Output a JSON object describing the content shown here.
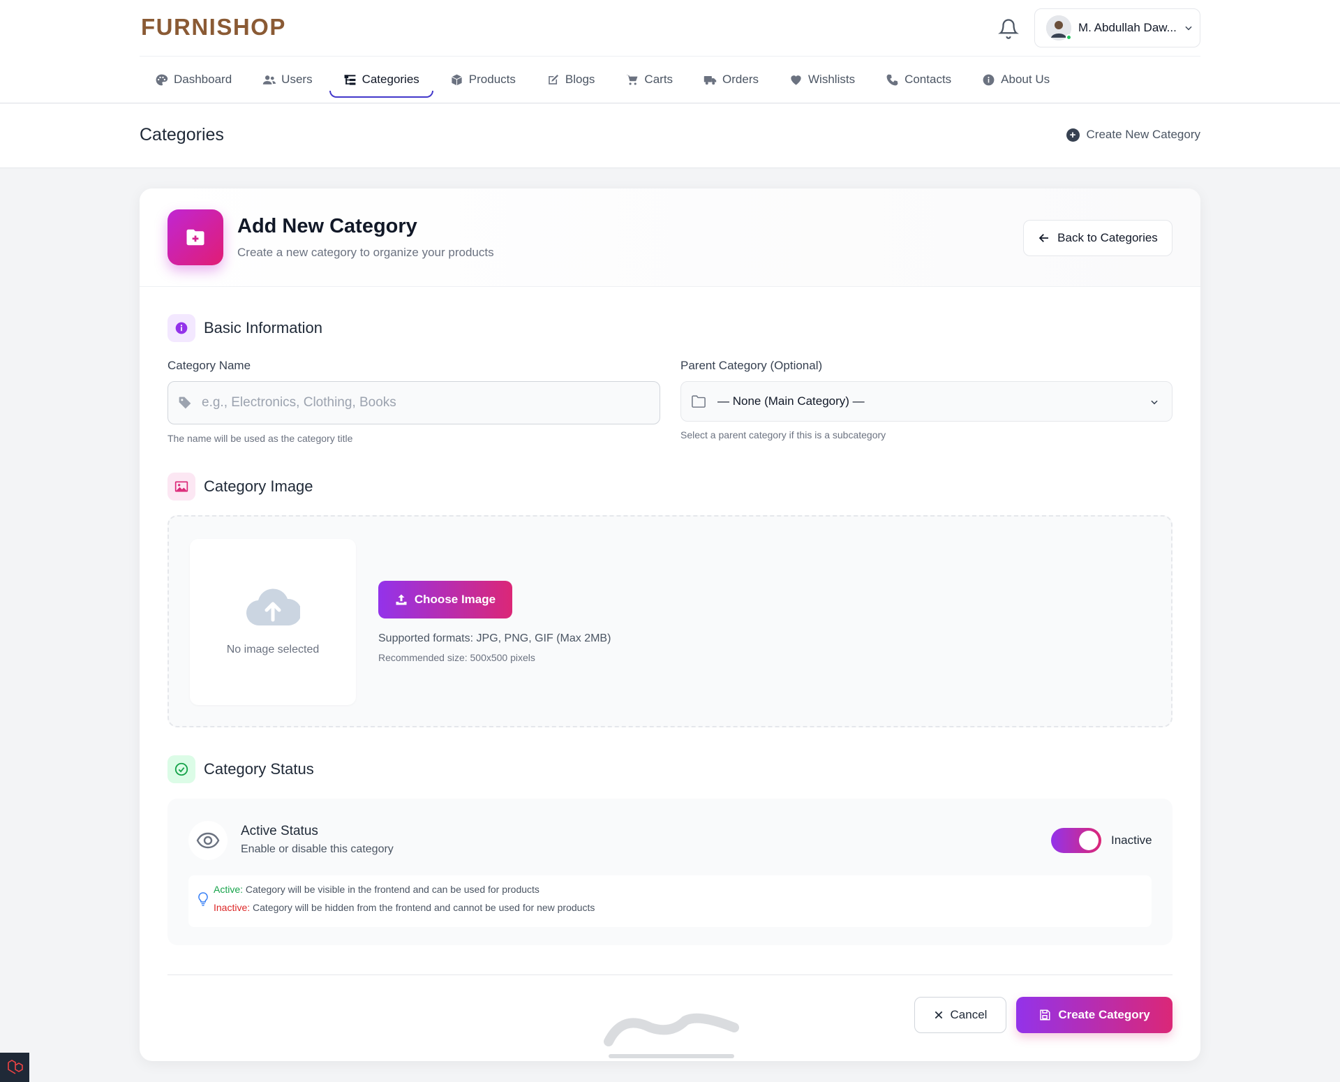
{
  "brand": "FURNISHOP",
  "user": {
    "name": "M. Abdullah Daw..."
  },
  "nav": [
    {
      "label": "Dashboard",
      "icon": "palette-icon"
    },
    {
      "label": "Users",
      "icon": "users-icon"
    },
    {
      "label": "Categories",
      "icon": "sitemap-icon",
      "active": true
    },
    {
      "label": "Products",
      "icon": "box-icon"
    },
    {
      "label": "Blogs",
      "icon": "edit-icon"
    },
    {
      "label": "Carts",
      "icon": "cart-icon"
    },
    {
      "label": "Orders",
      "icon": "truck-icon"
    },
    {
      "label": "Wishlists",
      "icon": "heart-icon"
    },
    {
      "label": "Contacts",
      "icon": "phone-icon"
    },
    {
      "label": "About Us",
      "icon": "info-icon"
    }
  ],
  "page": {
    "title": "Categories",
    "create_link": "Create New Category"
  },
  "card": {
    "title": "Add New Category",
    "subtitle": "Create a new category to organize your products",
    "back_label": "Back to Categories"
  },
  "basic": {
    "title": "Basic Information",
    "name_label": "Category Name",
    "name_placeholder": "e.g., Electronics, Clothing, Books",
    "name_hint": "The name will be used as the category title",
    "parent_label": "Parent Category (Optional)",
    "parent_value": "— None (Main Category) —",
    "parent_hint": "Select a parent category if this is a subcategory"
  },
  "image": {
    "title": "Category Image",
    "no_image": "No image selected",
    "choose_label": "Choose Image",
    "formats": "Supported formats: JPG, PNG, GIF (Max 2MB)",
    "recommended": "Recommended size: 500x500 pixels"
  },
  "status": {
    "title": "Category Status",
    "active_title": "Active Status",
    "active_sub": "Enable or disable this category",
    "toggle_label": "Inactive",
    "note_active_key": "Active:",
    "note_active_text": " Category will be visible in the frontend and can be used for products",
    "note_inactive_key": "Inactive:",
    "note_inactive_text": " Category will be hidden from the frontend and cannot be used for new products"
  },
  "actions": {
    "cancel": "Cancel",
    "submit": "Create Category"
  },
  "colors": {
    "brand": "#8a5a34",
    "accent_start": "#9333ea",
    "accent_end": "#db2777"
  }
}
